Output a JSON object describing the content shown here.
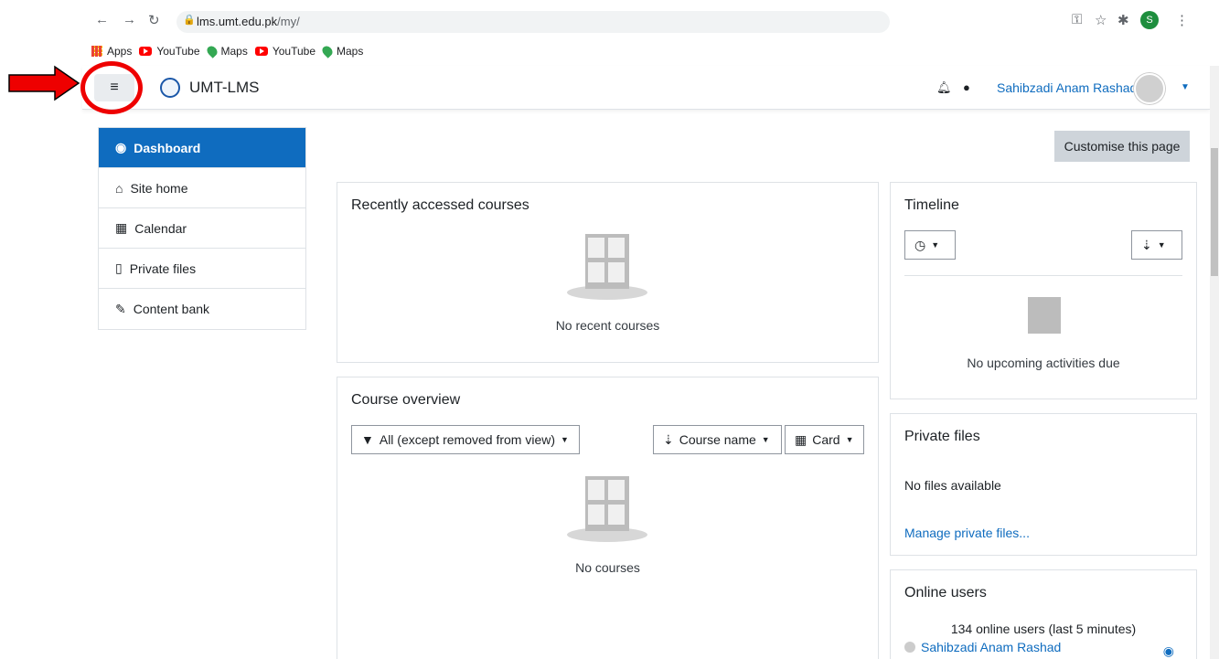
{
  "browser": {
    "url_host": "lms.umt.edu.pk",
    "url_path": "/my/",
    "profile_initial": "S",
    "bookmarks": [
      {
        "label": "Apps",
        "icon": "apps-icon"
      },
      {
        "label": "YouTube",
        "icon": "youtube-icon"
      },
      {
        "label": "Maps",
        "icon": "maps-icon"
      },
      {
        "label": "YouTube",
        "icon": "youtube-icon"
      },
      {
        "label": "Maps",
        "icon": "maps-icon"
      }
    ]
  },
  "navbar": {
    "brand": "UMT-LMS",
    "user_name": "Sahibzadi Anam Rashad"
  },
  "drawer": {
    "items": [
      {
        "label": "Dashboard",
        "icon": "dashboard-icon",
        "active": true
      },
      {
        "label": "Site home",
        "icon": "home-icon"
      },
      {
        "label": "Calendar",
        "icon": "calendar-icon"
      },
      {
        "label": "Private files",
        "icon": "file-icon"
      },
      {
        "label": "Content bank",
        "icon": "brush-icon"
      }
    ]
  },
  "customise_label": "Customise this page",
  "recent": {
    "title": "Recently accessed courses",
    "empty": "No recent courses"
  },
  "overview": {
    "title": "Course overview",
    "filter": "All (except removed from view)",
    "sort": "Course name",
    "view": "Card",
    "empty": "No courses"
  },
  "timeline": {
    "title": "Timeline",
    "empty": "No upcoming activities due"
  },
  "private_files": {
    "title": "Private files",
    "empty": "No files available",
    "manage": "Manage private files..."
  },
  "online": {
    "title": "Online users",
    "summary": "134 online users (last 5 minutes)",
    "user": "Sahibzadi Anam Rashad"
  },
  "colors": {
    "primary": "#0f6cbf",
    "annotation": "#ee0000"
  }
}
